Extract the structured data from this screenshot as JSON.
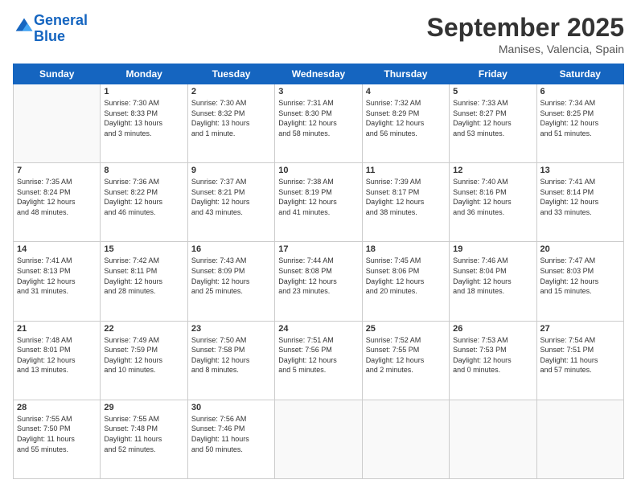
{
  "logo": {
    "line1": "General",
    "line2": "Blue"
  },
  "header": {
    "month": "September 2025",
    "location": "Manises, Valencia, Spain"
  },
  "weekdays": [
    "Sunday",
    "Monday",
    "Tuesday",
    "Wednesday",
    "Thursday",
    "Friday",
    "Saturday"
  ],
  "weeks": [
    [
      {
        "day": "",
        "info": ""
      },
      {
        "day": "1",
        "info": "Sunrise: 7:30 AM\nSunset: 8:33 PM\nDaylight: 13 hours\nand 3 minutes."
      },
      {
        "day": "2",
        "info": "Sunrise: 7:30 AM\nSunset: 8:32 PM\nDaylight: 13 hours\nand 1 minute."
      },
      {
        "day": "3",
        "info": "Sunrise: 7:31 AM\nSunset: 8:30 PM\nDaylight: 12 hours\nand 58 minutes."
      },
      {
        "day": "4",
        "info": "Sunrise: 7:32 AM\nSunset: 8:29 PM\nDaylight: 12 hours\nand 56 minutes."
      },
      {
        "day": "5",
        "info": "Sunrise: 7:33 AM\nSunset: 8:27 PM\nDaylight: 12 hours\nand 53 minutes."
      },
      {
        "day": "6",
        "info": "Sunrise: 7:34 AM\nSunset: 8:25 PM\nDaylight: 12 hours\nand 51 minutes."
      }
    ],
    [
      {
        "day": "7",
        "info": "Sunrise: 7:35 AM\nSunset: 8:24 PM\nDaylight: 12 hours\nand 48 minutes."
      },
      {
        "day": "8",
        "info": "Sunrise: 7:36 AM\nSunset: 8:22 PM\nDaylight: 12 hours\nand 46 minutes."
      },
      {
        "day": "9",
        "info": "Sunrise: 7:37 AM\nSunset: 8:21 PM\nDaylight: 12 hours\nand 43 minutes."
      },
      {
        "day": "10",
        "info": "Sunrise: 7:38 AM\nSunset: 8:19 PM\nDaylight: 12 hours\nand 41 minutes."
      },
      {
        "day": "11",
        "info": "Sunrise: 7:39 AM\nSunset: 8:17 PM\nDaylight: 12 hours\nand 38 minutes."
      },
      {
        "day": "12",
        "info": "Sunrise: 7:40 AM\nSunset: 8:16 PM\nDaylight: 12 hours\nand 36 minutes."
      },
      {
        "day": "13",
        "info": "Sunrise: 7:41 AM\nSunset: 8:14 PM\nDaylight: 12 hours\nand 33 minutes."
      }
    ],
    [
      {
        "day": "14",
        "info": "Sunrise: 7:41 AM\nSunset: 8:13 PM\nDaylight: 12 hours\nand 31 minutes."
      },
      {
        "day": "15",
        "info": "Sunrise: 7:42 AM\nSunset: 8:11 PM\nDaylight: 12 hours\nand 28 minutes."
      },
      {
        "day": "16",
        "info": "Sunrise: 7:43 AM\nSunset: 8:09 PM\nDaylight: 12 hours\nand 25 minutes."
      },
      {
        "day": "17",
        "info": "Sunrise: 7:44 AM\nSunset: 8:08 PM\nDaylight: 12 hours\nand 23 minutes."
      },
      {
        "day": "18",
        "info": "Sunrise: 7:45 AM\nSunset: 8:06 PM\nDaylight: 12 hours\nand 20 minutes."
      },
      {
        "day": "19",
        "info": "Sunrise: 7:46 AM\nSunset: 8:04 PM\nDaylight: 12 hours\nand 18 minutes."
      },
      {
        "day": "20",
        "info": "Sunrise: 7:47 AM\nSunset: 8:03 PM\nDaylight: 12 hours\nand 15 minutes."
      }
    ],
    [
      {
        "day": "21",
        "info": "Sunrise: 7:48 AM\nSunset: 8:01 PM\nDaylight: 12 hours\nand 13 minutes."
      },
      {
        "day": "22",
        "info": "Sunrise: 7:49 AM\nSunset: 7:59 PM\nDaylight: 12 hours\nand 10 minutes."
      },
      {
        "day": "23",
        "info": "Sunrise: 7:50 AM\nSunset: 7:58 PM\nDaylight: 12 hours\nand 8 minutes."
      },
      {
        "day": "24",
        "info": "Sunrise: 7:51 AM\nSunset: 7:56 PM\nDaylight: 12 hours\nand 5 minutes."
      },
      {
        "day": "25",
        "info": "Sunrise: 7:52 AM\nSunset: 7:55 PM\nDaylight: 12 hours\nand 2 minutes."
      },
      {
        "day": "26",
        "info": "Sunrise: 7:53 AM\nSunset: 7:53 PM\nDaylight: 12 hours\nand 0 minutes."
      },
      {
        "day": "27",
        "info": "Sunrise: 7:54 AM\nSunset: 7:51 PM\nDaylight: 11 hours\nand 57 minutes."
      }
    ],
    [
      {
        "day": "28",
        "info": "Sunrise: 7:55 AM\nSunset: 7:50 PM\nDaylight: 11 hours\nand 55 minutes."
      },
      {
        "day": "29",
        "info": "Sunrise: 7:55 AM\nSunset: 7:48 PM\nDaylight: 11 hours\nand 52 minutes."
      },
      {
        "day": "30",
        "info": "Sunrise: 7:56 AM\nSunset: 7:46 PM\nDaylight: 11 hours\nand 50 minutes."
      },
      {
        "day": "",
        "info": ""
      },
      {
        "day": "",
        "info": ""
      },
      {
        "day": "",
        "info": ""
      },
      {
        "day": "",
        "info": ""
      }
    ]
  ]
}
